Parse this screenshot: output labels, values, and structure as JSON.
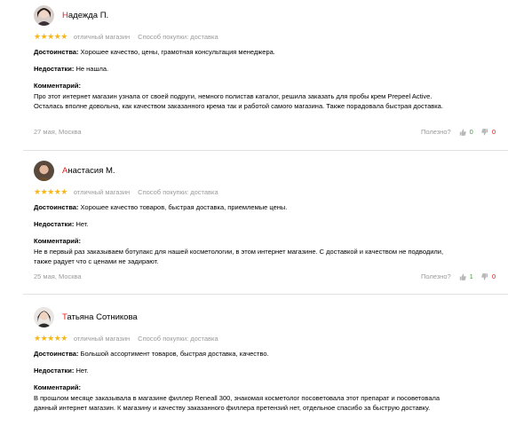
{
  "labels": {
    "pros": "Достоинства:",
    "cons": "Недостатки:",
    "comment": "Комментарий:",
    "helpful": "Полезно?"
  },
  "colors": {
    "star": "#f7b617",
    "accent_red": "#e0201c",
    "up": "#3aa235",
    "meta": "#9a9a9a"
  },
  "reviews": [
    {
      "author_initial": "Н",
      "author_rest": "адежда П.",
      "stars": "★★★★★",
      "rating_text": "отличный магазин",
      "purchase": "Способ покупки: доставка",
      "pros": "Хорошее качество, цены, грамотная консультация менеджера.",
      "cons": "Не нашла.",
      "comment": "Про этот интернет магазин узнала от своей подруги, немного полистав каталог, решила заказать для пробы крем Prepeel Active. Осталась вполне довольна, как качеством заказанного крема так и работой самого магазина. Также порадовала быстрая доставка.",
      "date": "27 мая, Москва",
      "up": "0",
      "down": "0"
    },
    {
      "author_initial": "А",
      "author_rest": "настасия М.",
      "stars": "★★★★★",
      "rating_text": "отличный магазин",
      "purchase": "Способ покупки: доставка",
      "pros": "Хорошее качество товаров, быстрая доставка, приемлемые цены.",
      "cons": "Нет.",
      "comment": "Не в первый раз заказываем ботулакс для нашей косметологии, в этом интернет магазине. С доставкой и качеством не подводили, также радует что с ценами не задирают.",
      "date": "25 мая, Москва",
      "up": "1",
      "down": "0"
    },
    {
      "author_initial": "Т",
      "author_rest": "атьяна Сотникова",
      "stars": "★★★★★",
      "rating_text": "отличный магазин",
      "purchase": "Способ покупки: доставка",
      "pros": "Большой ассортимент товаров, быстрая доставка, качество.",
      "cons": "Нет.",
      "comment": "В прошлом месяце заказывала в магазине филлер Reneall 300, знакомая косметолог посоветовала этот препарат и посоветовала данный интернет магазин. К магазину и качеству заказанного филлера претензий нет, отдельное спасибо за быструю доставку."
    }
  ]
}
